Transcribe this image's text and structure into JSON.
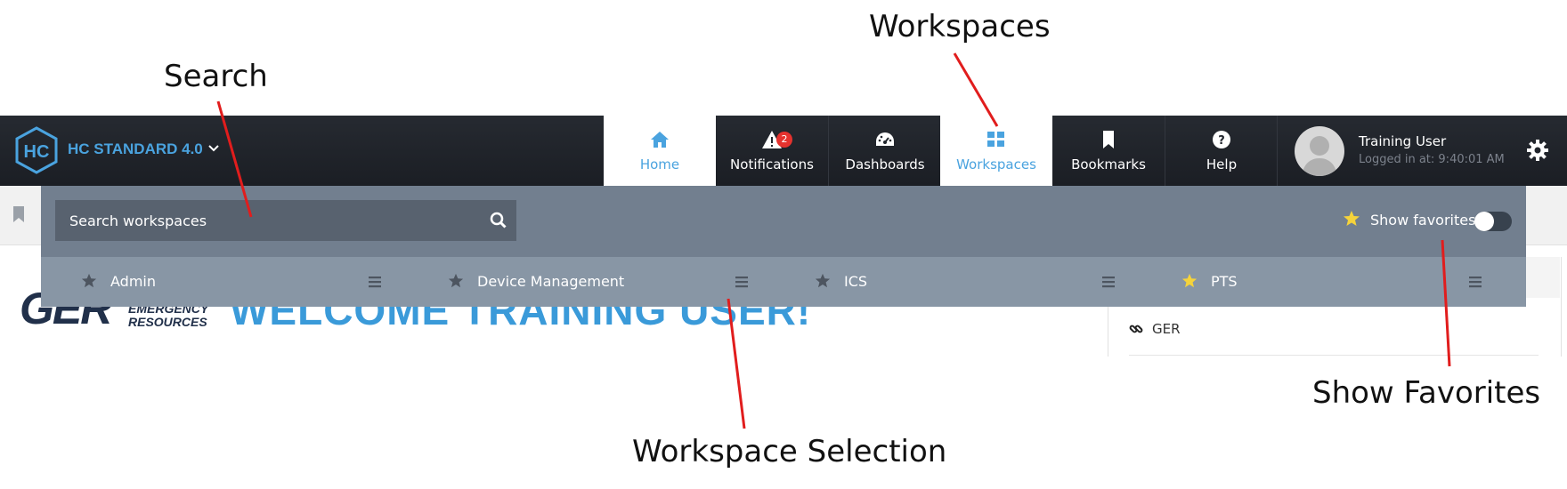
{
  "annotations": {
    "search": "Search",
    "workspaces": "Workspaces",
    "workspace_selection": "Workspace Selection",
    "show_favorites": "Show Favorites"
  },
  "brand": {
    "title": "HC STANDARD 4.0",
    "logo_icon": "hc-logo-icon",
    "color": "#4aa3df"
  },
  "nav": {
    "items": [
      {
        "label": "Home",
        "icon": "home-icon"
      },
      {
        "label": "Notifications",
        "icon": "warning-icon",
        "badge": "2"
      },
      {
        "label": "Dashboards",
        "icon": "gauge-icon"
      },
      {
        "label": "Workspaces",
        "icon": "grid-icon",
        "active": true
      },
      {
        "label": "Bookmarks",
        "icon": "bookmark-icon"
      },
      {
        "label": "Help",
        "icon": "help-icon"
      }
    ]
  },
  "user": {
    "name": "Training User",
    "logged_in": "Logged in at: 9:40:01 AM"
  },
  "page": {
    "welcome": "WELCOME TRAINING USER!",
    "logo_text": "GER",
    "logo_sub_line1": "EMERGENCY",
    "logo_sub_line2": "RESOURCES",
    "side_link": "GER"
  },
  "workspaces_panel": {
    "search_placeholder": "Search workspaces",
    "show_favorites_label": "Show favorites",
    "show_favorites_on": false,
    "items": [
      {
        "name": "Admin",
        "favorite": false
      },
      {
        "name": "Device Management",
        "favorite": false
      },
      {
        "name": "ICS",
        "favorite": false
      },
      {
        "name": "PTS",
        "favorite": true
      }
    ]
  },
  "colors": {
    "navbar": "#21252c",
    "dropdown": "#727f8f",
    "row": "#8896a5",
    "accent": "#4aa3df",
    "favorite_star": "#f5d33b",
    "annotation_line": "#e11d1d"
  }
}
